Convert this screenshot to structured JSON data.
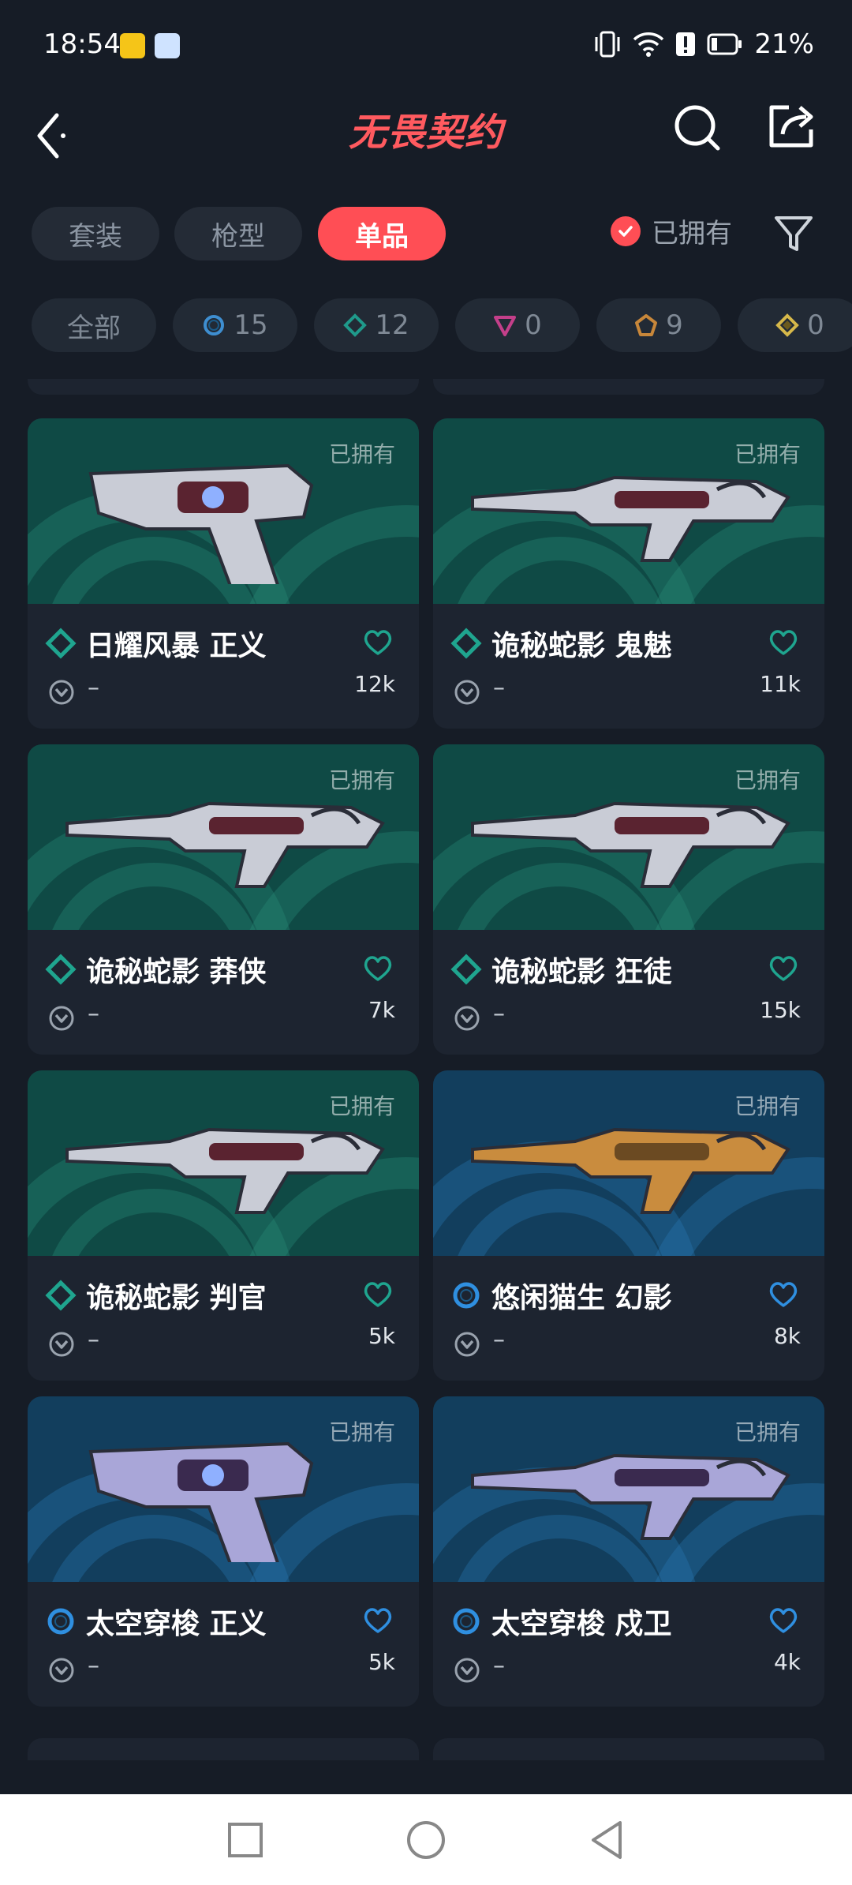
{
  "status_bar": {
    "time": "18:54",
    "battery": "21%"
  },
  "header": {
    "title": "无畏契约"
  },
  "tabs": [
    {
      "label": "套装",
      "active": false
    },
    {
      "label": "枪型",
      "active": false
    },
    {
      "label": "单品",
      "active": true
    }
  ],
  "owned_filter": {
    "label": "已拥有"
  },
  "rarity_chips": [
    {
      "label": "全部",
      "icon": ""
    },
    {
      "label": "15",
      "icon": "select-tier-icon",
      "color": "#3e8ed0"
    },
    {
      "label": "12",
      "icon": "deluxe-tier-icon",
      "color": "#1f9a8b"
    },
    {
      "label": "0",
      "icon": "premium-tier-icon",
      "color": "#c43f8a"
    },
    {
      "label": "9",
      "icon": "exclusive-tier-icon",
      "color": "#c8873a"
    },
    {
      "label": "0",
      "icon": "ultra-tier-icon",
      "color": "#d6b84a"
    }
  ],
  "cards": [
    {
      "name": "日耀风暴 正义",
      "tier": "deluxe",
      "level": "–",
      "likes": "12k",
      "owned_tag": "已拥有",
      "bg": "green"
    },
    {
      "name": "诡秘蛇影 鬼魅",
      "tier": "deluxe",
      "level": "–",
      "likes": "11k",
      "owned_tag": "已拥有",
      "bg": "green"
    },
    {
      "name": "诡秘蛇影 莽侠",
      "tier": "deluxe",
      "level": "–",
      "likes": "7k",
      "owned_tag": "已拥有",
      "bg": "green"
    },
    {
      "name": "诡秘蛇影 狂徒",
      "tier": "deluxe",
      "level": "–",
      "likes": "15k",
      "owned_tag": "已拥有",
      "bg": "green"
    },
    {
      "name": "诡秘蛇影 判官",
      "tier": "deluxe",
      "level": "–",
      "likes": "5k",
      "owned_tag": "已拥有",
      "bg": "green"
    },
    {
      "name": "悠闲猫生 幻影",
      "tier": "select",
      "level": "–",
      "likes": "8k",
      "owned_tag": "已拥有",
      "bg": "blue"
    },
    {
      "name": "太空穿梭 正义",
      "tier": "select",
      "level": "–",
      "likes": "5k",
      "owned_tag": "已拥有",
      "bg": "blue"
    },
    {
      "name": "太空穿梭 戍卫",
      "tier": "select",
      "level": "–",
      "likes": "4k",
      "owned_tag": "已拥有",
      "bg": "blue"
    }
  ],
  "colors": {
    "accent": "#ff4e55",
    "deluxe": "#1fa58f",
    "select": "#2f8fe0",
    "background": "#161c26",
    "card": "#1d2430"
  }
}
